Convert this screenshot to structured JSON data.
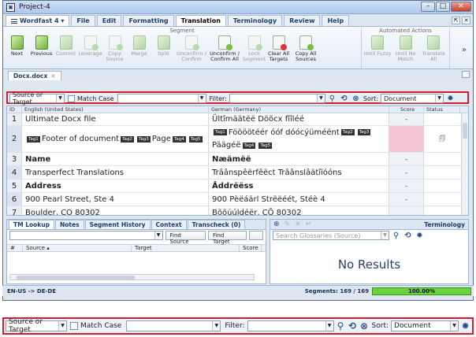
{
  "window": {
    "title": "Project-4"
  },
  "menubar": {
    "app_menu": "Wordfast 4",
    "items": [
      "File",
      "Edit",
      "Formatting",
      "Translation",
      "Terminology",
      "Review",
      "Help"
    ],
    "active": "Translation"
  },
  "ribbon": {
    "segment_group": "Segment",
    "automated_group": "Automated Actions",
    "buttons": [
      {
        "label": "Next",
        "enabled": true
      },
      {
        "label": "Previous",
        "enabled": true
      },
      {
        "label": "Commit",
        "enabled": false
      },
      {
        "label": "Leverage",
        "enabled": false
      },
      {
        "label": "Copy Source",
        "enabled": false
      },
      {
        "label": "Merge",
        "enabled": false
      },
      {
        "label": "Split",
        "enabled": false
      },
      {
        "label": "Unconfirm / Confirm",
        "enabled": false
      },
      {
        "label": "Unconfirm / Confirm All",
        "enabled": true
      },
      {
        "label": "Lock Segment",
        "enabled": false
      },
      {
        "label": "Clear All Targets",
        "enabled": true
      },
      {
        "label": "Copy All Sources",
        "enabled": true
      }
    ],
    "auto_buttons": [
      {
        "label": "Until Fuzzy",
        "enabled": false
      },
      {
        "label": "Until No Match",
        "enabled": false
      },
      {
        "label": "Translate All",
        "enabled": false
      }
    ],
    "overflow": "»"
  },
  "doc_tab": {
    "label": "Docx.docx"
  },
  "filter": {
    "mode": "Source or Target",
    "match_case_label": "Match Case",
    "filter_label": "Filter:",
    "sort_label": "Sort:",
    "sort_value": "Document"
  },
  "grid": {
    "headers": {
      "id": "ID",
      "source": "English (United States)",
      "target": "German (Germany)",
      "score": "Score",
      "status": "Status"
    },
    "rows": [
      {
        "id": "1",
        "source": "Ultimate Docx file",
        "target": "Ültîmäätëë Döõcx fîîléé",
        "score": "-"
      },
      {
        "id": "2",
        "source_tags": [
          "Tag1"
        ],
        "source": "Footer of document",
        "source_tags2": [
          "Tag2",
          "Tag3"
        ],
        "source_b": "Page",
        "source_tags3": [
          "Tag4",
          "Tag5"
        ],
        "target_tags": [
          "Tag1"
        ],
        "target": "Föööötéér óóf dóócýüméënt",
        "target_tags2": [
          "Tag2",
          "Tag3"
        ],
        "target_b": "Päägéë",
        "target_tags3": [
          "Tag4",
          "Tag5"
        ],
        "score": ""
      },
      {
        "id": "3",
        "source": "Name",
        "target": "Næämëë",
        "score": "-"
      },
      {
        "id": "4",
        "source": "Transperfect Translations",
        "target": "Trâânspêërfêëct Trâânslâätîïóóns",
        "score": "-"
      },
      {
        "id": "5",
        "source": "Address",
        "target": "Åddrëëss",
        "score": "-"
      },
      {
        "id": "6",
        "source": "900 Pearl Street, Ste 4",
        "target": "900 Pèëáärl Strëëéét, Stéè 4",
        "score": "-"
      },
      {
        "id": "7",
        "source": "Boulder, CO 80302",
        "target": "Bõõúúldéër, CÕ 80302",
        "score": ""
      }
    ]
  },
  "tm_panel": {
    "tabs": [
      "TM Lookup",
      "Notes",
      "Segment History",
      "Context",
      "Transcheck (0)"
    ],
    "find_source": "Find Source",
    "find_target": "Find Target",
    "cols": [
      "#",
      "Source",
      "Target",
      "Score"
    ]
  },
  "term_panel": {
    "title": "Terminology",
    "search_placeholder": "Search Glossaries (Source)",
    "empty": "No Results"
  },
  "status": {
    "lang_pair": "EN-US -> DE-DE",
    "segments": "Segments: 169 / 169",
    "progress": "100.00%",
    "progress_value": 100
  }
}
